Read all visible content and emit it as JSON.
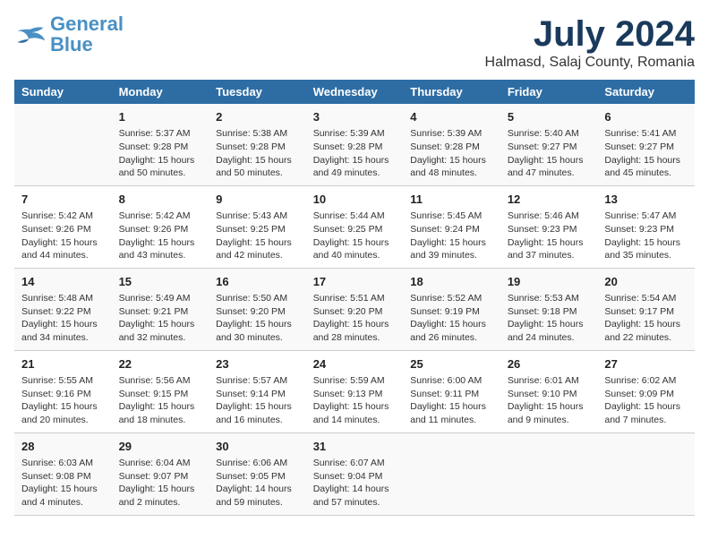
{
  "header": {
    "logo_general": "General",
    "logo_blue": "Blue",
    "title": "July 2024",
    "subtitle": "Halmasd, Salaj County, Romania"
  },
  "weekdays": [
    "Sunday",
    "Monday",
    "Tuesday",
    "Wednesday",
    "Thursday",
    "Friday",
    "Saturday"
  ],
  "weeks": [
    [
      {
        "day": "",
        "info": ""
      },
      {
        "day": "1",
        "info": "Sunrise: 5:37 AM\nSunset: 9:28 PM\nDaylight: 15 hours\nand 50 minutes."
      },
      {
        "day": "2",
        "info": "Sunrise: 5:38 AM\nSunset: 9:28 PM\nDaylight: 15 hours\nand 50 minutes."
      },
      {
        "day": "3",
        "info": "Sunrise: 5:39 AM\nSunset: 9:28 PM\nDaylight: 15 hours\nand 49 minutes."
      },
      {
        "day": "4",
        "info": "Sunrise: 5:39 AM\nSunset: 9:28 PM\nDaylight: 15 hours\nand 48 minutes."
      },
      {
        "day": "5",
        "info": "Sunrise: 5:40 AM\nSunset: 9:27 PM\nDaylight: 15 hours\nand 47 minutes."
      },
      {
        "day": "6",
        "info": "Sunrise: 5:41 AM\nSunset: 9:27 PM\nDaylight: 15 hours\nand 45 minutes."
      }
    ],
    [
      {
        "day": "7",
        "info": "Sunrise: 5:42 AM\nSunset: 9:26 PM\nDaylight: 15 hours\nand 44 minutes."
      },
      {
        "day": "8",
        "info": "Sunrise: 5:42 AM\nSunset: 9:26 PM\nDaylight: 15 hours\nand 43 minutes."
      },
      {
        "day": "9",
        "info": "Sunrise: 5:43 AM\nSunset: 9:25 PM\nDaylight: 15 hours\nand 42 minutes."
      },
      {
        "day": "10",
        "info": "Sunrise: 5:44 AM\nSunset: 9:25 PM\nDaylight: 15 hours\nand 40 minutes."
      },
      {
        "day": "11",
        "info": "Sunrise: 5:45 AM\nSunset: 9:24 PM\nDaylight: 15 hours\nand 39 minutes."
      },
      {
        "day": "12",
        "info": "Sunrise: 5:46 AM\nSunset: 9:23 PM\nDaylight: 15 hours\nand 37 minutes."
      },
      {
        "day": "13",
        "info": "Sunrise: 5:47 AM\nSunset: 9:23 PM\nDaylight: 15 hours\nand 35 minutes."
      }
    ],
    [
      {
        "day": "14",
        "info": "Sunrise: 5:48 AM\nSunset: 9:22 PM\nDaylight: 15 hours\nand 34 minutes."
      },
      {
        "day": "15",
        "info": "Sunrise: 5:49 AM\nSunset: 9:21 PM\nDaylight: 15 hours\nand 32 minutes."
      },
      {
        "day": "16",
        "info": "Sunrise: 5:50 AM\nSunset: 9:20 PM\nDaylight: 15 hours\nand 30 minutes."
      },
      {
        "day": "17",
        "info": "Sunrise: 5:51 AM\nSunset: 9:20 PM\nDaylight: 15 hours\nand 28 minutes."
      },
      {
        "day": "18",
        "info": "Sunrise: 5:52 AM\nSunset: 9:19 PM\nDaylight: 15 hours\nand 26 minutes."
      },
      {
        "day": "19",
        "info": "Sunrise: 5:53 AM\nSunset: 9:18 PM\nDaylight: 15 hours\nand 24 minutes."
      },
      {
        "day": "20",
        "info": "Sunrise: 5:54 AM\nSunset: 9:17 PM\nDaylight: 15 hours\nand 22 minutes."
      }
    ],
    [
      {
        "day": "21",
        "info": "Sunrise: 5:55 AM\nSunset: 9:16 PM\nDaylight: 15 hours\nand 20 minutes."
      },
      {
        "day": "22",
        "info": "Sunrise: 5:56 AM\nSunset: 9:15 PM\nDaylight: 15 hours\nand 18 minutes."
      },
      {
        "day": "23",
        "info": "Sunrise: 5:57 AM\nSunset: 9:14 PM\nDaylight: 15 hours\nand 16 minutes."
      },
      {
        "day": "24",
        "info": "Sunrise: 5:59 AM\nSunset: 9:13 PM\nDaylight: 15 hours\nand 14 minutes."
      },
      {
        "day": "25",
        "info": "Sunrise: 6:00 AM\nSunset: 9:11 PM\nDaylight: 15 hours\nand 11 minutes."
      },
      {
        "day": "26",
        "info": "Sunrise: 6:01 AM\nSunset: 9:10 PM\nDaylight: 15 hours\nand 9 minutes."
      },
      {
        "day": "27",
        "info": "Sunrise: 6:02 AM\nSunset: 9:09 PM\nDaylight: 15 hours\nand 7 minutes."
      }
    ],
    [
      {
        "day": "28",
        "info": "Sunrise: 6:03 AM\nSunset: 9:08 PM\nDaylight: 15 hours\nand 4 minutes."
      },
      {
        "day": "29",
        "info": "Sunrise: 6:04 AM\nSunset: 9:07 PM\nDaylight: 15 hours\nand 2 minutes."
      },
      {
        "day": "30",
        "info": "Sunrise: 6:06 AM\nSunset: 9:05 PM\nDaylight: 14 hours\nand 59 minutes."
      },
      {
        "day": "31",
        "info": "Sunrise: 6:07 AM\nSunset: 9:04 PM\nDaylight: 14 hours\nand 57 minutes."
      },
      {
        "day": "",
        "info": ""
      },
      {
        "day": "",
        "info": ""
      },
      {
        "day": "",
        "info": ""
      }
    ]
  ]
}
